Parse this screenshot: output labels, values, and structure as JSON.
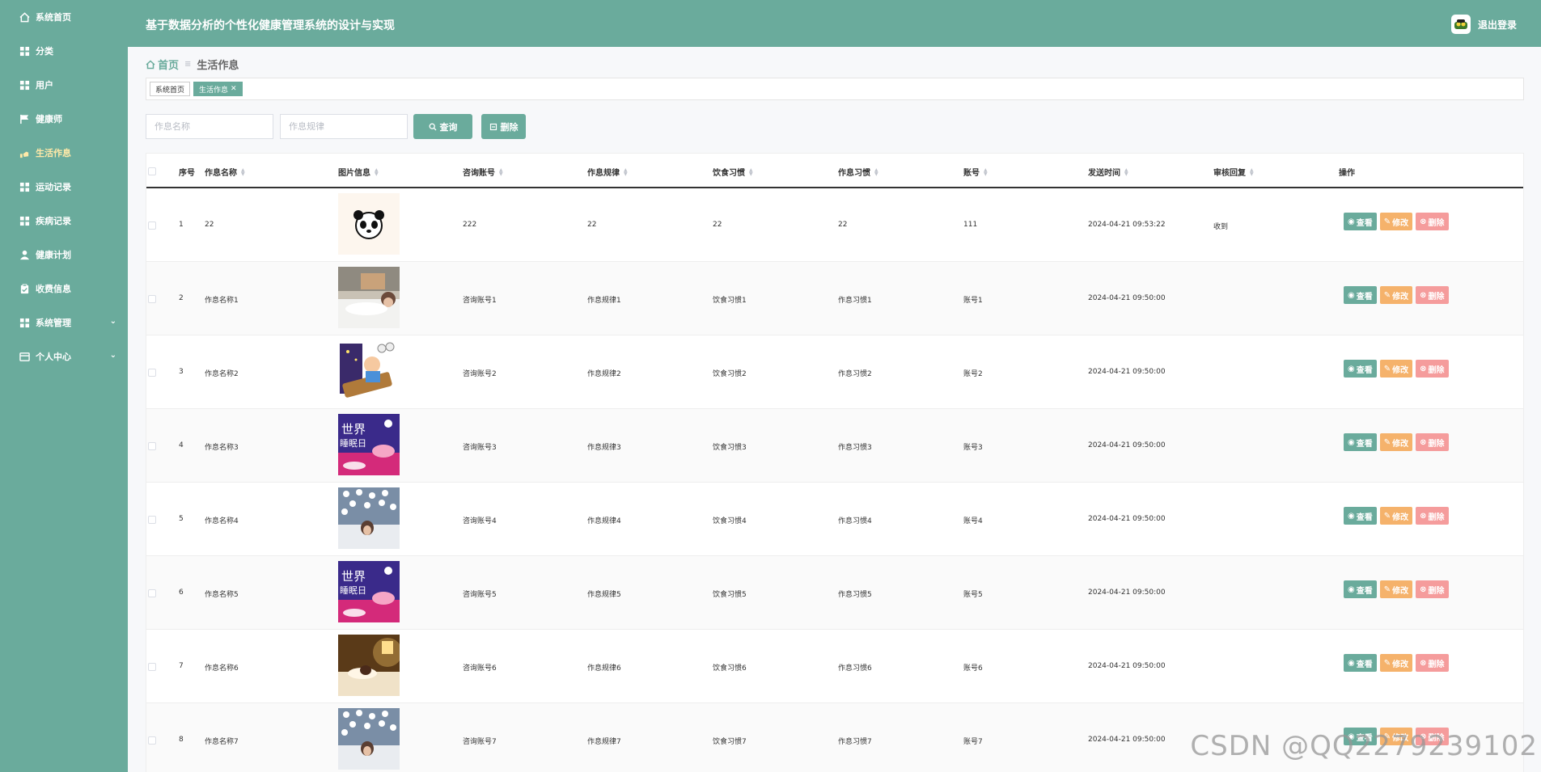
{
  "sidebar": {
    "items": [
      {
        "label": "系统首页",
        "icon": "home-icon"
      },
      {
        "label": "分类",
        "icon": "grid-icon"
      },
      {
        "label": "用户",
        "icon": "grid-icon"
      },
      {
        "label": "健康师",
        "icon": "flag-icon"
      },
      {
        "label": "生活作息",
        "icon": "hand-icon",
        "active": true
      },
      {
        "label": "运动记录",
        "icon": "grid-icon"
      },
      {
        "label": "疾病记录",
        "icon": "grid-icon"
      },
      {
        "label": "健康计划",
        "icon": "user-icon"
      },
      {
        "label": "收费信息",
        "icon": "clipboard-icon"
      },
      {
        "label": "系统管理",
        "icon": "grid-icon",
        "expandable": true
      },
      {
        "label": "个人中心",
        "icon": "card-icon",
        "expandable": true
      }
    ]
  },
  "header": {
    "title": "基于数据分析的个性化健康管理系统的设计与实现",
    "logout": "退出登录"
  },
  "breadcrumb": {
    "home": "首页",
    "current": "生活作息"
  },
  "tags": [
    {
      "label": "系统首页"
    },
    {
      "label": "生活作息",
      "active": true
    }
  ],
  "search": {
    "name_placeholder": "作息名称",
    "rule_placeholder": "作息规律",
    "query_label": "查询",
    "delete_label": "删除"
  },
  "table": {
    "columns": [
      "序号",
      "作息名称",
      "图片信息",
      "咨询账号",
      "作息规律",
      "饮食习惯",
      "作息习惯",
      "账号",
      "发送时间",
      "审核回复",
      "操作"
    ],
    "rows": [
      {
        "index": "1",
        "name": "22",
        "image": "panda-icon",
        "account": "222",
        "rule": "22",
        "diet": "22",
        "habit": "22",
        "user": "111",
        "time": "2024-04-21 09:53:22",
        "reply": "收到"
      },
      {
        "index": "2",
        "name": "作息名称1",
        "image": "sleeping-person",
        "account": "咨询账号1",
        "rule": "作息规律1",
        "diet": "饮食习惯1",
        "habit": "作息习惯1",
        "user": "账号1",
        "time": "2024-04-21 09:50:00",
        "reply": ""
      },
      {
        "index": "3",
        "name": "作息名称2",
        "image": "cartoon-bed",
        "account": "咨询账号2",
        "rule": "作息规律2",
        "diet": "饮食习惯2",
        "habit": "作息习惯2",
        "user": "账号2",
        "time": "2024-04-21 09:50:00",
        "reply": ""
      },
      {
        "index": "4",
        "name": "作息名称3",
        "image": "world-sleep-day",
        "account": "咨询账号3",
        "rule": "作息规律3",
        "diet": "饮食习惯3",
        "habit": "作息习惯3",
        "user": "账号3",
        "time": "2024-04-21 09:50:00",
        "reply": ""
      },
      {
        "index": "5",
        "name": "作息名称4",
        "image": "insomnia-sheep",
        "account": "咨询账号4",
        "rule": "作息规律4",
        "diet": "饮食习惯4",
        "habit": "作息习惯4",
        "user": "账号4",
        "time": "2024-04-21 09:50:00",
        "reply": ""
      },
      {
        "index": "6",
        "name": "作息名称5",
        "image": "world-sleep-day",
        "account": "咨询账号5",
        "rule": "作息规律5",
        "diet": "饮食习惯5",
        "habit": "作息习惯5",
        "user": "账号5",
        "time": "2024-04-21 09:50:00",
        "reply": ""
      },
      {
        "index": "7",
        "name": "作息名称6",
        "image": "lamp-bed",
        "account": "咨询账号6",
        "rule": "作息规律6",
        "diet": "饮食习惯6",
        "habit": "作息习惯6",
        "user": "账号6",
        "time": "2024-04-21 09:50:00",
        "reply": ""
      },
      {
        "index": "8",
        "name": "作息名称7",
        "image": "insomnia-sheep",
        "account": "咨询账号7",
        "rule": "作息规律7",
        "diet": "饮食习惯7",
        "habit": "作息习惯7",
        "user": "账号7",
        "time": "2024-04-21 09:50:00",
        "reply": ""
      }
    ],
    "actions": {
      "view": "查看",
      "edit": "修改",
      "delete": "删除"
    }
  },
  "world_sleep_text": {
    "line1": "世界",
    "line2": "睡眠日"
  },
  "watermark": "CSDN @QQ2279239102",
  "colors": {
    "primary": "#6aab9c",
    "edit": "#f5b26b",
    "delete": "#f59c9c"
  }
}
